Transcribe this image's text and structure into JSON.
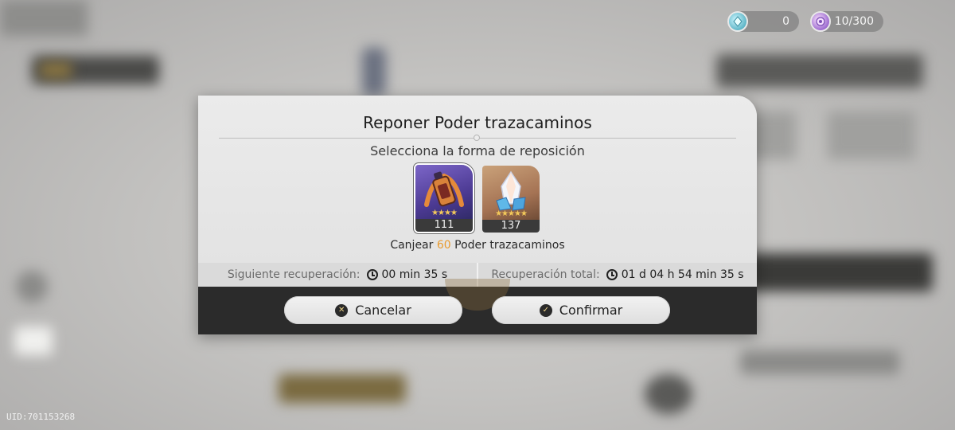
{
  "currency": {
    "first": {
      "icon": "crystal-currency-icon",
      "value": "0"
    },
    "second": {
      "icon": "trailblaze-power-icon",
      "value": "10/300"
    }
  },
  "uid": "UID:701153268",
  "dialog": {
    "title": "Reponer Poder trazacaminos",
    "subtitle": "Selecciona la forma de reposición",
    "items": [
      {
        "icon": "fuel-item-icon",
        "count": "111",
        "stars": "★★★★",
        "selected": true
      },
      {
        "icon": "stellar-jade-item-icon",
        "count": "137",
        "stars": "★★★★★",
        "selected": false
      }
    ],
    "redeem": {
      "prefix": "Canjear",
      "amount": "60",
      "suffix": "Poder trazacaminos"
    },
    "next_recovery": {
      "label": "Siguiente recuperación:",
      "time": "00 min 35 s"
    },
    "total_recovery": {
      "label": "Recuperación total:",
      "time": "01 d 04 h 54 min 35 s"
    },
    "buttons": {
      "cancel": "Cancelar",
      "confirm": "Confirmar"
    }
  },
  "colors": {
    "accent": "#e99b2f",
    "dark_bar": "#2b2b2b"
  }
}
